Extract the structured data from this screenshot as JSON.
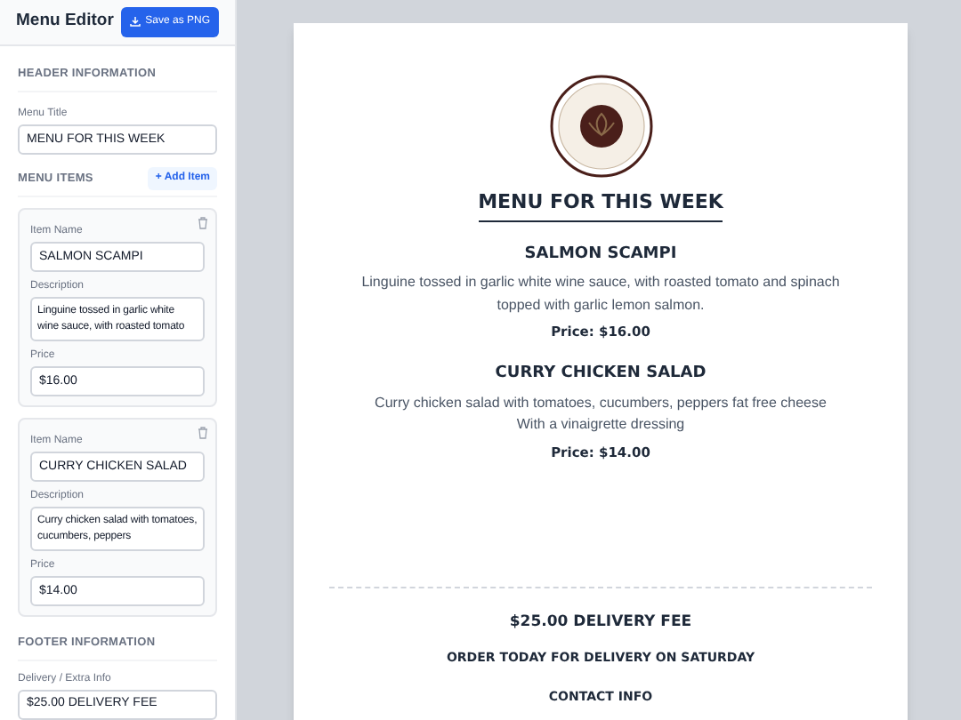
{
  "editor": {
    "title": "Menu Editor",
    "save_button": "Save as PNG",
    "header_section": {
      "heading": "HEADER INFORMATION",
      "title_label": "Menu Title",
      "title_value": "MENU FOR THIS WEEK"
    },
    "items_section": {
      "heading": "MENU ITEMS",
      "add_button": "+ Add Item",
      "items": [
        {
          "name_label": "Item Name",
          "name": "SALMON SCAMPI",
          "description_label": "Description",
          "description": "Linguine tossed in garlic white wine sauce, with roasted tomato",
          "price_label": "Price",
          "price": "$16.00"
        },
        {
          "name_label": "Item Name",
          "name": "CURRY CHICKEN SALAD",
          "description_label": "Description",
          "description": "Curry chicken salad with tomatoes, cucumbers, peppers",
          "price_label": "Price",
          "price": "$14.00"
        }
      ]
    },
    "footer_section": {
      "heading": "FOOTER INFORMATION",
      "delivery_label": "Delivery / Extra Info",
      "delivery_value": "$25.00 DELIVERY FEE"
    }
  },
  "preview": {
    "title": "MENU FOR THIS WEEK",
    "items": [
      {
        "name": "SALMON SCAMPI",
        "description": "Linguine tossed in garlic white wine sauce, with roasted tomato and spinach topped with garlic lemon salmon.",
        "price": "Price: $16.00"
      },
      {
        "name": "CURRY CHICKEN SALAD",
        "description": "Curry chicken salad with tomatoes, cucumbers, peppers fat free cheese With a vinaigrette dressing",
        "price": "Price: $14.00"
      }
    ],
    "delivery": "$25.00 DELIVERY FEE",
    "order_note": "ORDER TODAY FOR DELIVERY ON SATURDAY",
    "contact_heading": "CONTACT INFO"
  }
}
